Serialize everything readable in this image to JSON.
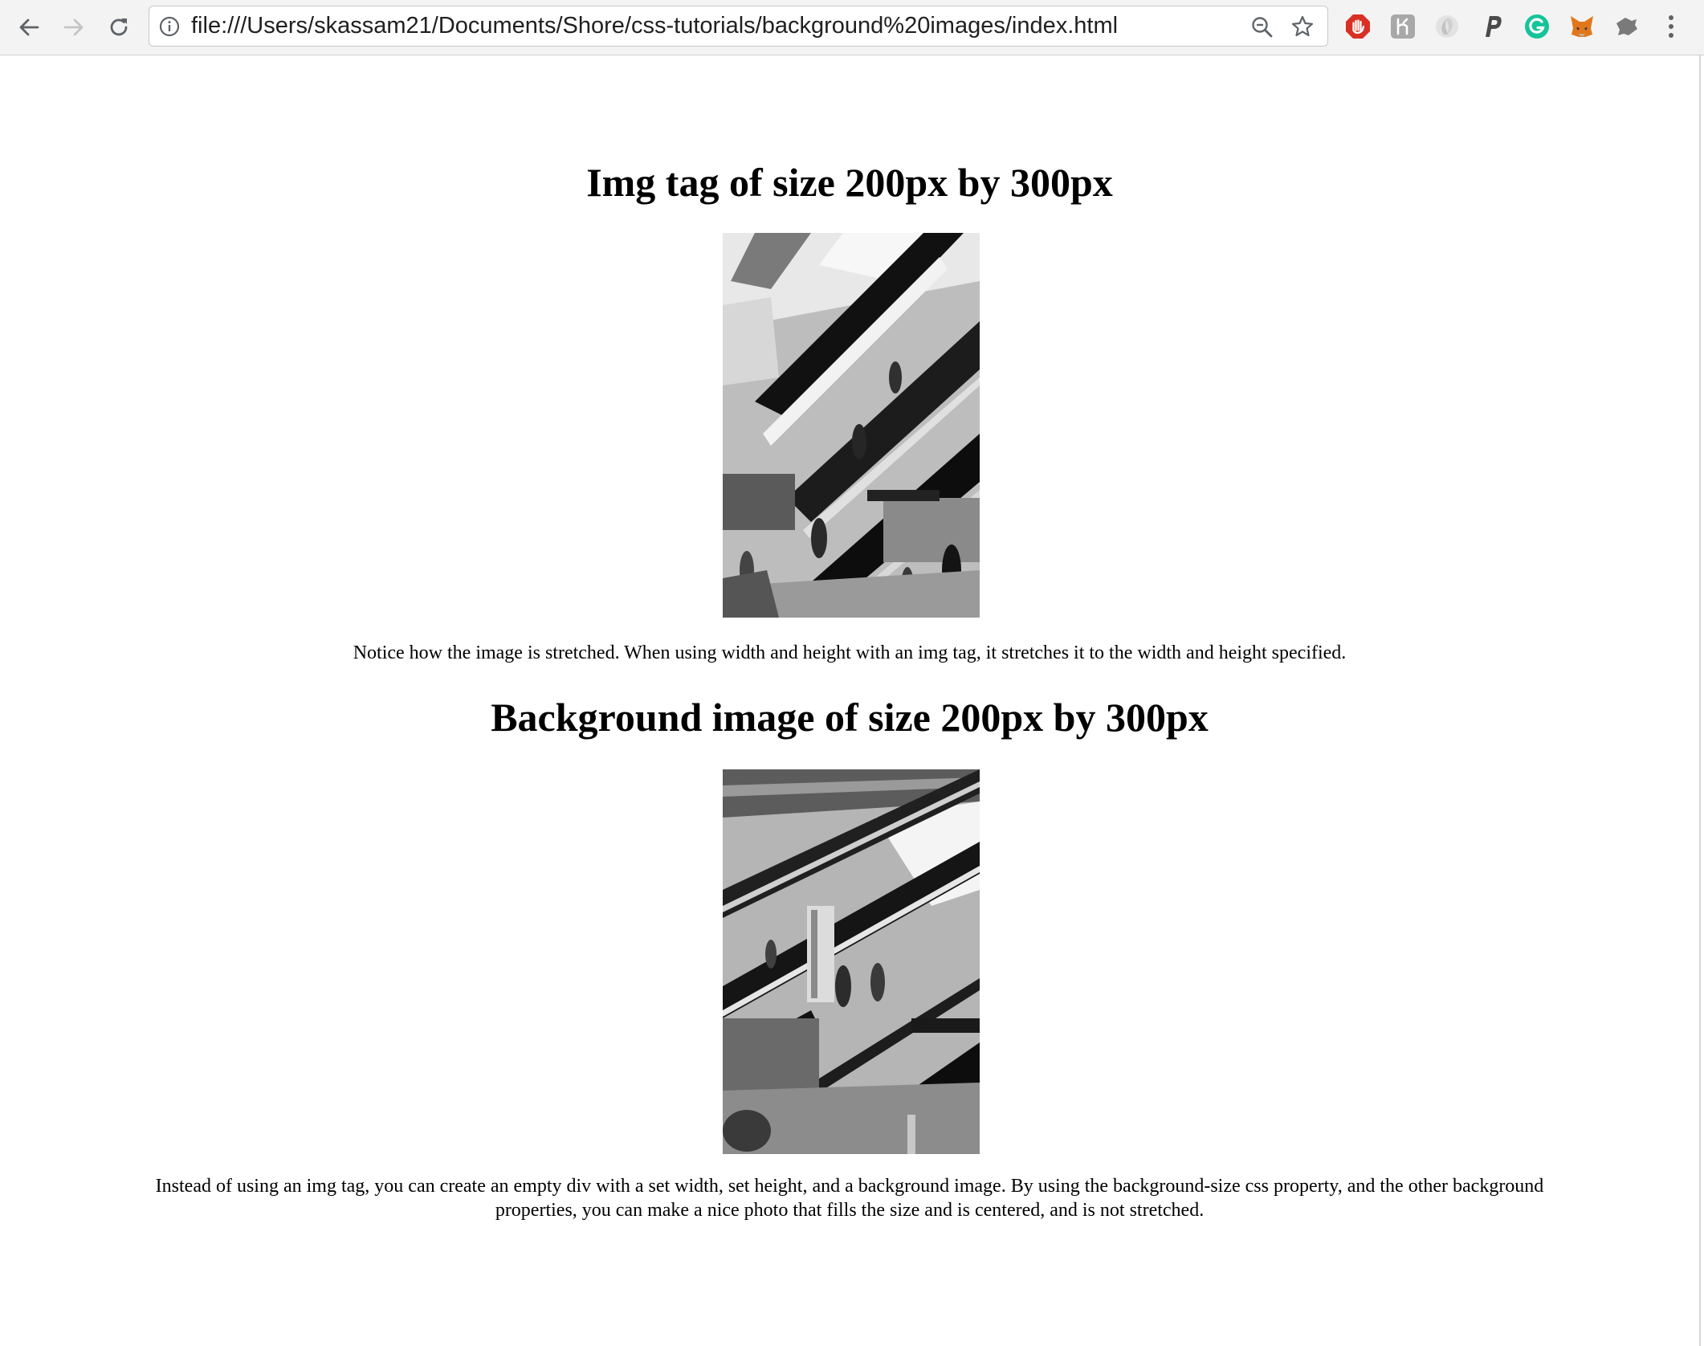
{
  "browser": {
    "url": "file:///Users/skassam21/Documents/Shore/css-tutorials/background%20images/index.html",
    "back_icon": "arrow-left-icon",
    "forward_icon": "arrow-right-icon",
    "reload_icon": "reload-icon",
    "site_info_icon": "info-icon",
    "zoom_icon": "zoom-out-icon",
    "bookmark_icon": "star-icon",
    "extensions": [
      {
        "name": "ad-blocker-extension-icon",
        "color": "#d93025"
      },
      {
        "name": "grey-box-extension-icon",
        "color": "#9e9e9e"
      },
      {
        "name": "faded-extension-icon",
        "color": "#cfcfcf"
      },
      {
        "name": "paypal-extension-icon",
        "color": "#555555"
      },
      {
        "name": "grammarly-extension-icon",
        "color": "#15c39a"
      },
      {
        "name": "metamask-extension-icon",
        "color": "#e2761b"
      },
      {
        "name": "puzzle-extension-icon",
        "color": "#7a7a7a"
      }
    ],
    "menu_icon": "kebab-menu-icon"
  },
  "content": {
    "heading_img": "Img tag of size 200px by 300px",
    "caption_img": "Notice how the image is stretched. When using width and height with an img tag, it stretches it to the width and height specified.",
    "heading_bg": "Background image of size 200px by 300px",
    "caption_bg_line1": "Instead of using an img tag, you can create an empty div with a set width, set height, and a background image. By using the background-size css property, and the other background",
    "caption_bg_line2": "properties, you can make a nice photo that fills the size and is centered, and is not stretched."
  }
}
